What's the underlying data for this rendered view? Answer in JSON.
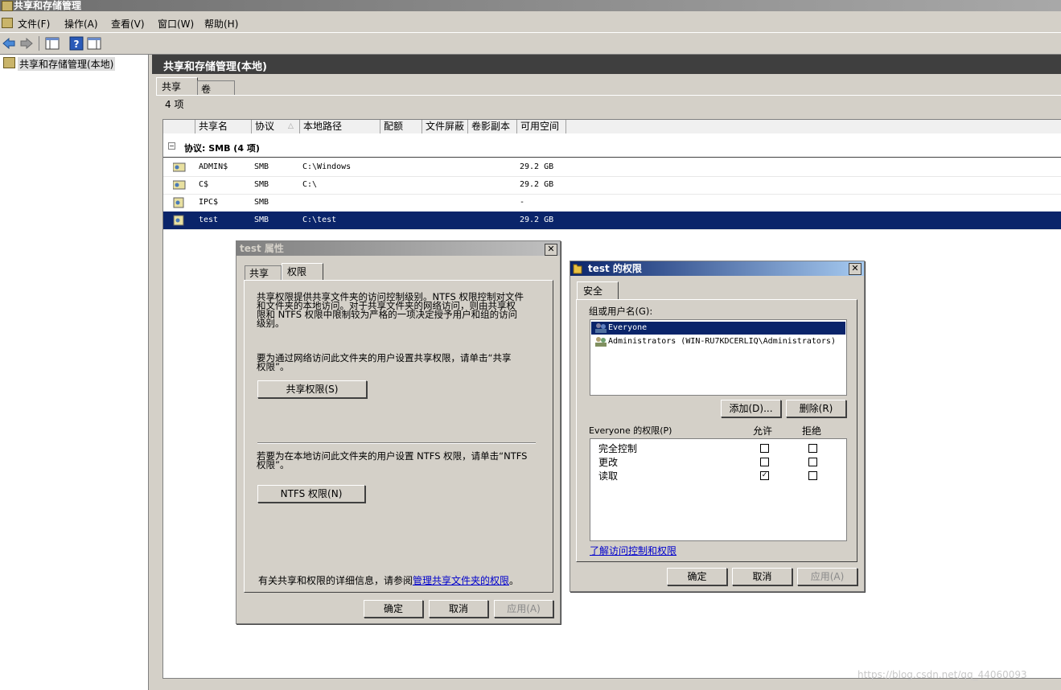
{
  "window": {
    "title": "共享和存储管理"
  },
  "menu": [
    "文件(F)",
    "操作(A)",
    "查看(V)",
    "窗口(W)",
    "帮助(H)"
  ],
  "tree": {
    "root": "共享和存储管理(本地)"
  },
  "right_pane": {
    "header": "共享和存储管理(本地)",
    "tabs": [
      "共享",
      "卷"
    ],
    "count": "4 项",
    "columns": [
      "共享名",
      "协议",
      "本地路径",
      "配额",
      "文件屏蔽",
      "卷影副本",
      "可用空间"
    ],
    "group": "协议: SMB (4 项)",
    "rows": [
      {
        "name": "ADMIN$",
        "protocol": "SMB",
        "path": "C:\\Windows",
        "free": "29.2 GB"
      },
      {
        "name": "C$",
        "protocol": "SMB",
        "path": "C:\\",
        "free": "29.2 GB"
      },
      {
        "name": "IPC$",
        "protocol": "SMB",
        "path": "",
        "free": "-"
      },
      {
        "name": "test",
        "protocol": "SMB",
        "path": "C:\\test",
        "free": "29.2 GB"
      }
    ]
  },
  "props_dialog": {
    "title": "test 属性",
    "tabs": [
      "共享",
      "权限"
    ],
    "para1": [
      "共享权限提供共享文件夹的访问控制级别。NTFS 权限控制对文件",
      "和文件夹的本地访问。对于共享文件夹的网络访问，则由共享权",
      "限和 NTFS 权限中限制较为严格的一项决定授予用户和组的访问",
      "级别。"
    ],
    "para2": [
      "要为通过网络访问此文件夹的用户设置共享权限，请单击“共享",
      "权限”。"
    ],
    "share_perm_btn": "共享权限(S)",
    "para3": [
      "若要为在本地访问此文件夹的用户设置 NTFS 权限，请单击“NTFS",
      "权限”。"
    ],
    "ntfs_perm_btn": "NTFS 权限(N)",
    "info_prefix": "有关共享和权限的详细信息，请参阅",
    "info_link": "管理共享文件夹的权限",
    "info_suffix": "。",
    "ok": "确定",
    "cancel": "取消",
    "apply": "应用(A)"
  },
  "perm_dialog": {
    "title": "test 的权限",
    "tab": "安全",
    "group_label": "组或用户名(G):",
    "users": [
      "Everyone",
      "Administrators (WIN-RU7KDCERLIQ\\Administrators)"
    ],
    "add_btn": "添加(D)...",
    "remove_btn": "删除(R)",
    "perm_label": "Everyone 的权限(P)",
    "allow": "允许",
    "deny": "拒绝",
    "perms": [
      {
        "name": "完全控制",
        "allow": false,
        "deny": false
      },
      {
        "name": "更改",
        "allow": false,
        "deny": false
      },
      {
        "name": "读取",
        "allow": true,
        "deny": false
      }
    ],
    "learn_link": "了解访问控制和权限",
    "ok": "确定",
    "cancel": "取消",
    "apply": "应用(A)"
  },
  "watermark": "https://blog.csdn.net/qq_44060093",
  "colors": {
    "selection": "#0a246a",
    "header": "#3f3f3f",
    "face": "#d4d0c8"
  }
}
